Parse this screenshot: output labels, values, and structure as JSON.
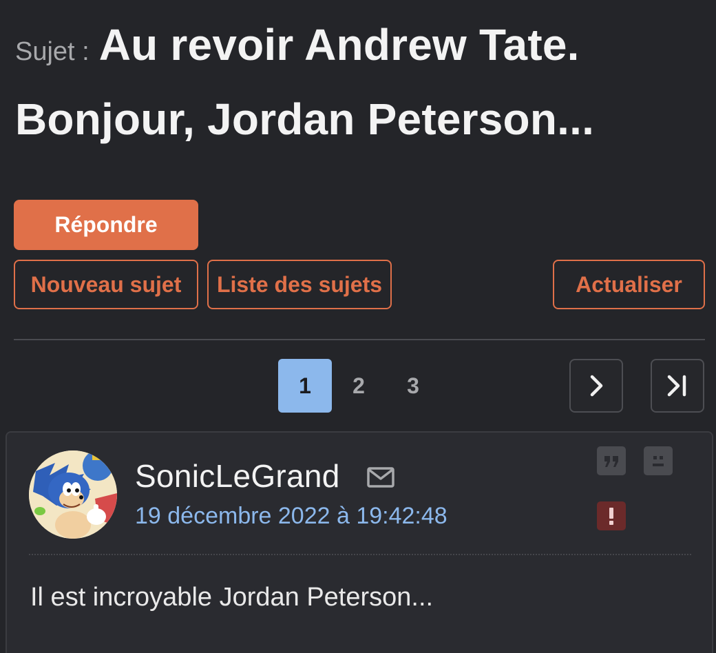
{
  "topic": {
    "prefix": "Sujet :",
    "title": "Au revoir Andrew Tate. Bonjour, Jordan Peterson..."
  },
  "actions": {
    "reply_label": "Répondre",
    "new_topic_label": "Nouveau sujet",
    "topic_list_label": "Liste des sujets",
    "refresh_label": "Actualiser"
  },
  "pagination": {
    "pages": [
      "1",
      "2",
      "3"
    ],
    "current_page": "1",
    "next_icon": "chevron-right-icon",
    "last_icon": "last-page-icon"
  },
  "post": {
    "author": "SonicLeGrand",
    "date": "19 décembre 2022 à 19:42:48",
    "body": "Il est incroyable Jordan Peterson...",
    "icons": [
      "mail-icon",
      "quote-icon",
      "sad-face-icon",
      "alert-icon"
    ]
  },
  "colors": {
    "background": "#242529",
    "accent": "#e07049",
    "link_blue": "#8cb8ec",
    "card": "#2a2b30"
  }
}
